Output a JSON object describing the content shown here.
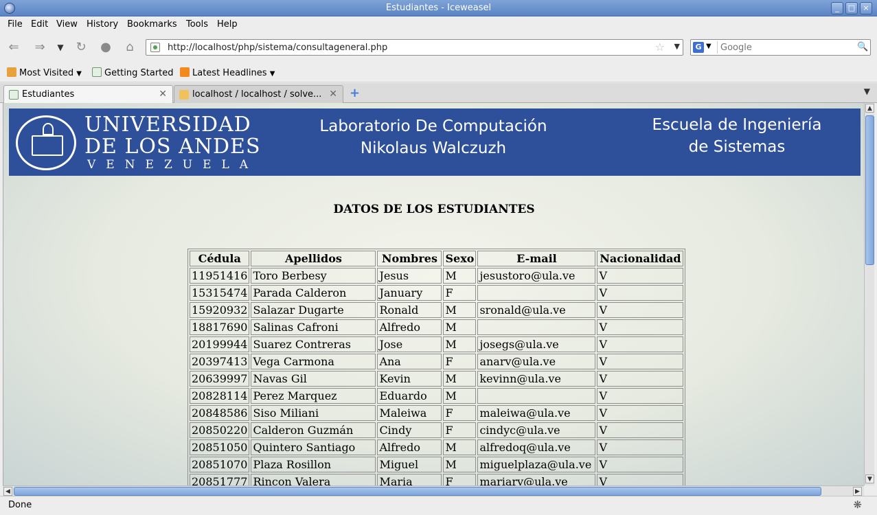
{
  "window": {
    "title": "Estudiantes - Iceweasel"
  },
  "menu": [
    "File",
    "Edit",
    "View",
    "History",
    "Bookmarks",
    "Tools",
    "Help"
  ],
  "nav": {
    "url": "http://localhost/php/sistema/consultageneral.php",
    "search_placeholder": "Google",
    "search_engine": "G"
  },
  "bookmarks": [
    "Most Visited",
    "Getting Started",
    "Latest Headlines"
  ],
  "tabs": [
    {
      "label": "Estudiantes",
      "active": true
    },
    {
      "label": "localhost / localhost / solve...",
      "active": false
    }
  ],
  "banner": {
    "logo_line1": "UNIVERSIDAD",
    "logo_line2": "DE LOS ANDES",
    "logo_line3": "VENEZUELA",
    "center_line1": "Laboratorio De Computación",
    "center_line2": "Nikolaus Walczuzh",
    "right_line1": "Escuela de Ingeniería",
    "right_line2": "de Sistemas"
  },
  "page": {
    "heading": "DATOS DE LOS ESTUDIANTES"
  },
  "table": {
    "headers": [
      "Cédula",
      "Apellidos",
      "Nombres",
      "Sexo",
      "E-mail",
      "Nacionalidad"
    ],
    "rows": [
      [
        "11951416",
        "Toro Berbesy",
        "Jesus",
        "M",
        "jesustoro@ula.ve",
        "V"
      ],
      [
        "15315474",
        "Parada Calderon",
        "January",
        "F",
        "",
        "V"
      ],
      [
        "15920932",
        "Salazar Dugarte",
        "Ronald",
        "M",
        "sronald@ula.ve",
        "V"
      ],
      [
        "18817690",
        "Salinas Cafroni",
        "Alfredo",
        "M",
        "",
        "V"
      ],
      [
        "20199944",
        "Suarez Contreras",
        "Jose",
        "M",
        "josegs@ula.ve",
        "V"
      ],
      [
        "20397413",
        "Vega Carmona",
        "Ana",
        "F",
        "anarv@ula.ve",
        "V"
      ],
      [
        "20639997",
        "Navas Gil",
        "Kevin",
        "M",
        "kevinn@ula.ve",
        "V"
      ],
      [
        "20828114",
        "Perez Marquez",
        "Eduardo",
        "M",
        "",
        "V"
      ],
      [
        "20848586",
        "Siso Miliani",
        "Maleiwa",
        "F",
        "maleiwa@ula.ve",
        "V"
      ],
      [
        "20850220",
        "Calderon Guzmán",
        "Cindy",
        "F",
        "cindyc@ula.ve",
        "V"
      ],
      [
        "20851050",
        "Quintero Santiago",
        "Alfredo",
        "M",
        "alfredoq@ula.ve",
        "V"
      ],
      [
        "20851070",
        "Plaza Rosillon",
        "Miguel",
        "M",
        "miguelplaza@ula.ve",
        "V"
      ],
      [
        "20851777",
        "Rincon Valera",
        "Maria",
        "F",
        "mariarv@ula.ve",
        "V"
      ]
    ]
  },
  "status": {
    "text": "Done"
  },
  "colors": {
    "banner": "#2e4f9a",
    "titlebar": "#5b84c4",
    "scroll_thumb": "#7ea5dc"
  }
}
